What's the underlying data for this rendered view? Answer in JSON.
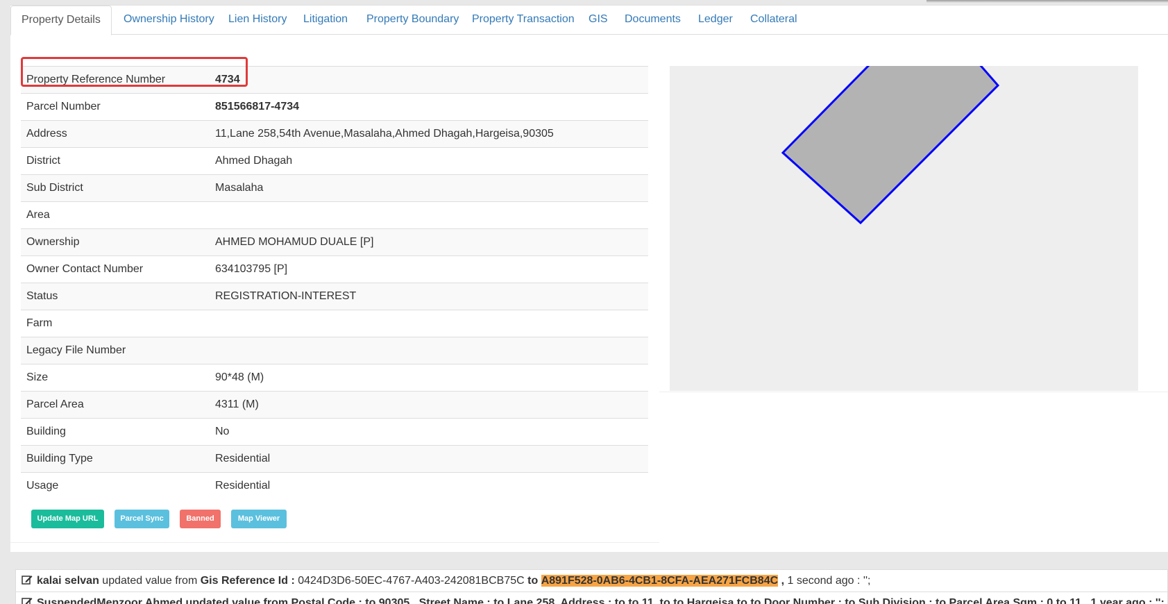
{
  "tabs": [
    {
      "label": "Property Details"
    },
    {
      "label": "Ownership History"
    },
    {
      "label": "Lien History"
    },
    {
      "label": "Litigation"
    },
    {
      "label": "Property Boundary"
    },
    {
      "label": "Property Transaction"
    },
    {
      "label": "GIS"
    },
    {
      "label": "Documents"
    },
    {
      "label": "Ledger"
    },
    {
      "label": "Collateral"
    }
  ],
  "details": [
    {
      "label": "Property Reference Number",
      "value": "4734"
    },
    {
      "label": "Parcel Number",
      "value": "851566817-4734"
    },
    {
      "label": "Address",
      "value": "11,Lane 258,54th Avenue,Masalaha,Ahmed Dhagah,Hargeisa,90305"
    },
    {
      "label": "District",
      "value": "Ahmed Dhagah"
    },
    {
      "label": "Sub District",
      "value": "Masalaha"
    },
    {
      "label": "Area",
      "value": ""
    },
    {
      "label": "Ownership",
      "value": "AHMED MOHAMUD DUALE [P]"
    },
    {
      "label": "Owner Contact Number",
      "value": "634103795 [P]"
    },
    {
      "label": "Status",
      "value": "REGISTRATION-INTEREST"
    },
    {
      "label": "Farm",
      "value": ""
    },
    {
      "label": "Legacy File Number",
      "value": ""
    },
    {
      "label": "Size",
      "value": "90*48 (M)"
    },
    {
      "label": "Parcel Area",
      "value": "4311 (M)"
    },
    {
      "label": "Building",
      "value": "No"
    },
    {
      "label": "Building Type",
      "value": "Residential"
    },
    {
      "label": "Usage",
      "value": "Residential"
    }
  ],
  "buttons": {
    "update_map": "Update Map URL",
    "parcel_sync": "Parcel Sync",
    "banned": "Banned",
    "map_viewer": "Map Viewer"
  },
  "map": {
    "fill_color": "#b3b3b3",
    "stroke_color": "#0000ff",
    "background": "#eeeeee"
  },
  "log": [
    {
      "user": "kalai selvan",
      "action": "updated value from",
      "field": "Gis Reference Id :",
      "old_value": "0424D3D6-50EC-4767-A403-242081BCB75C",
      "to_text": "to",
      "new_value": "A891F528-0AB6-4CB1-8CFA-AEA271FCB84C",
      "comma": ",",
      "time": "1 second ago : '';"
    },
    {
      "text": "SuspendedMenzoor Ahmed updated value from Postal Code : to 90305 , Street Name : to Lane 258, Address : to to 11, to to Hargeisa to to Door Number : to Sub Division : to Parcel Area Sqm : 0 to 11 , 1 year ago : '';"
    }
  ],
  "colors": {
    "tab_link": "#337ab7",
    "highlight_border": "#e03a3a",
    "btn_green": "#1abc9c",
    "btn_blue": "#5bc0de",
    "btn_red": "#f0726a",
    "log_highlight": "#f7a444"
  }
}
